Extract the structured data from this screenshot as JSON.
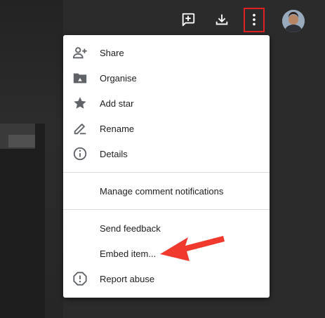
{
  "topbar": {
    "icons": [
      "add-comment-icon",
      "download-icon",
      "more-vert-icon",
      "avatar"
    ]
  },
  "menu": {
    "items": [
      {
        "label": "Share",
        "icon": "person-add-icon"
      },
      {
        "label": "Organise",
        "icon": "drive-folder-icon"
      },
      {
        "label": "Add star",
        "icon": "star-icon"
      },
      {
        "label": "Rename",
        "icon": "edit-icon"
      },
      {
        "label": "Details",
        "icon": "info-icon"
      },
      {
        "label": "Manage comment notifications"
      },
      {
        "label": "Send feedback"
      },
      {
        "label": "Embed item..."
      },
      {
        "label": "Report abuse",
        "icon": "report-icon"
      }
    ]
  },
  "colors": {
    "background": "#2b2b2b",
    "menu": "#ffffff",
    "icon_gray": "#5f6368",
    "highlight": "#e02020",
    "arrow": "#f03a2e"
  }
}
